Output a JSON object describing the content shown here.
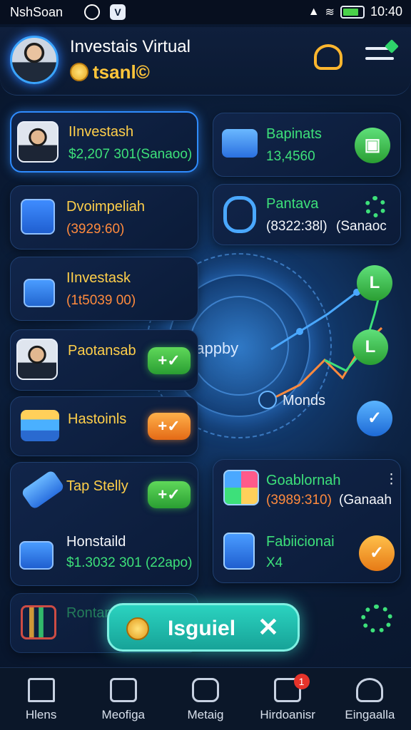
{
  "status_bar": {
    "carrier": "NshSoan",
    "time": "10:40",
    "battery_level": 0.8
  },
  "header": {
    "title": "Investais Virtual",
    "subtitle": "tsanl©"
  },
  "left_cards": [
    {
      "title": "IInvestash",
      "value": "$2,207 301(Sanaoo)"
    },
    {
      "title": "Dvoimpeliah",
      "value": "(3929:60)"
    },
    {
      "title": "IInvestask",
      "value": "(1t5039 00)"
    },
    {
      "title": "Paotansab",
      "action": "+✓"
    },
    {
      "title": "Hastoinls",
      "action": "+✓"
    },
    {
      "title": "Tap Stelly",
      "action": "+✓"
    },
    {
      "title": "Honstaild",
      "value": "$1.3032 301 (22apo)"
    },
    {
      "title": "Rontan"
    }
  ],
  "right_cards": [
    {
      "title": "Bapinats",
      "value": "13,4560"
    },
    {
      "title": "Pantava",
      "value": "(8322:38l)",
      "value2": "(Sanaoc"
    },
    {
      "title": "Goablornah",
      "value": "(3989:310)",
      "value2": "(Ganaah"
    },
    {
      "title": "Fabiicionai",
      "value": "X4"
    }
  ],
  "center": {
    "label": "aappby",
    "legend": "Monds"
  },
  "action_button": {
    "label": "Isguiel",
    "close": "✕"
  },
  "bottom_nav": [
    {
      "label": "Hlens",
      "icon": "home-icon"
    },
    {
      "label": "Meofiga",
      "icon": "mail-icon"
    },
    {
      "label": "Metaig",
      "icon": "gamepad-icon"
    },
    {
      "label": "Hirdoanisr",
      "icon": "tasks-icon",
      "badge": "1"
    },
    {
      "label": "Eingaalla",
      "icon": "profile-icon"
    }
  ],
  "colors": {
    "accent_yellow": "#ffcf4a",
    "accent_green": "#3de07a",
    "accent_orange": "#ff8a3d",
    "accent_blue": "#2f8cff",
    "action_teal": "#1fbfb0"
  }
}
